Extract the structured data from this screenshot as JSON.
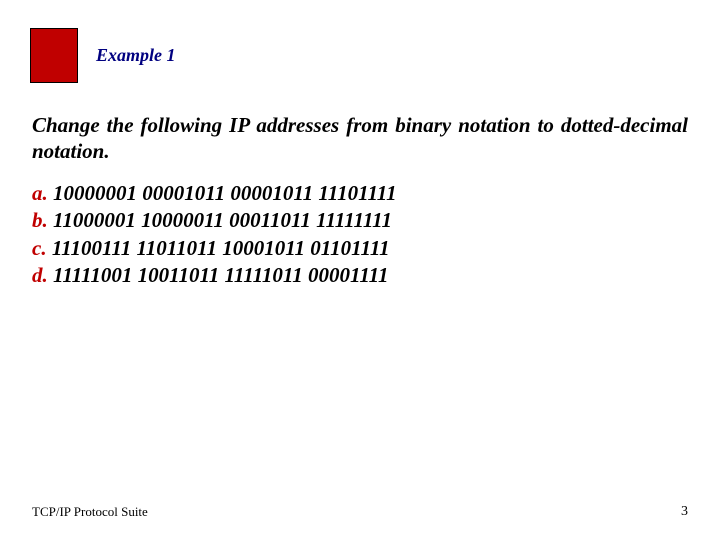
{
  "header": {
    "title": "Example 1"
  },
  "prompt": "Change the following IP addresses from binary notation to dotted-decimal notation.",
  "items": [
    {
      "label": "a.",
      "value": "10000001 00001011 00001011 11101111"
    },
    {
      "label": "b.",
      "value": "11000001 10000011 00011011 11111111"
    },
    {
      "label": "c.",
      "value": "11100111 11011011 10001011 01101111"
    },
    {
      "label": "d.",
      "value": "11111001 10011011 11111011 00001111"
    }
  ],
  "footer": {
    "left": "TCP/IP Protocol Suite",
    "page": "3"
  }
}
